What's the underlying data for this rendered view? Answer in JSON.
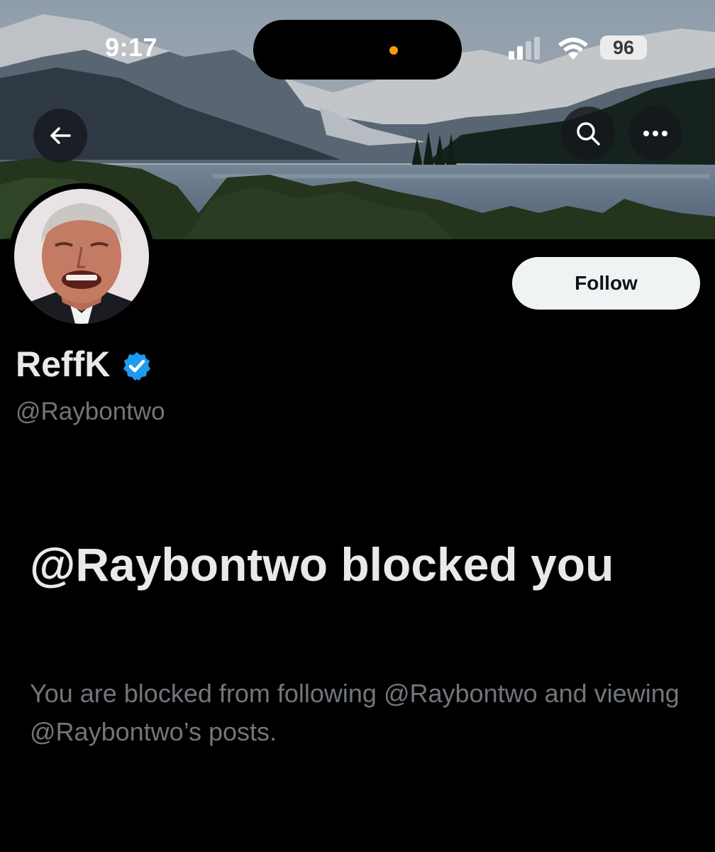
{
  "status_bar": {
    "time": "9:17",
    "battery": "96"
  },
  "header": {
    "back_icon": "arrow-left-icon",
    "search_icon": "search-icon",
    "more_icon": "more-horizontal-icon"
  },
  "profile": {
    "display_name": "ReffK",
    "handle": "@Raybontwo",
    "verified": true,
    "follow_label": "Follow"
  },
  "blocked": {
    "title": "@Raybontwo blocked you",
    "description": "You are blocked from following @Raybontwo and viewing @Raybontwo’s posts."
  },
  "colors": {
    "background": "#000000",
    "verified_badge": "#1d9bf0",
    "follow_button": "#eff3f4",
    "secondary_text": "#71767b"
  }
}
